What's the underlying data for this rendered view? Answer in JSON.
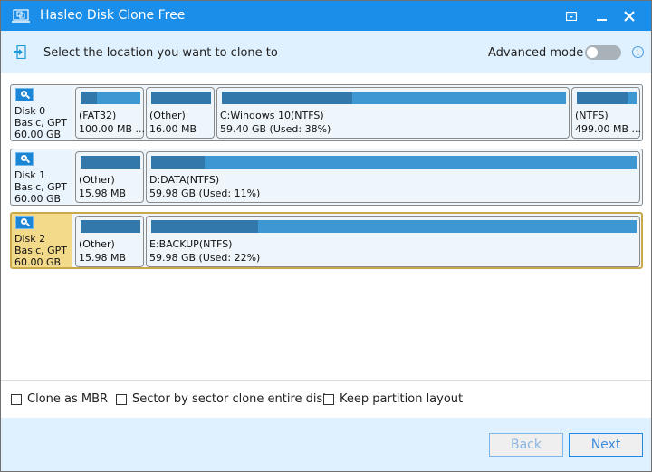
{
  "window": {
    "title": "Hasleo Disk Clone Free",
    "controls": [
      "menu",
      "minimize",
      "close"
    ]
  },
  "header": {
    "instruction": "Select the location you want to clone to",
    "advanced_mode_label": "Advanced mode",
    "advanced_mode_on": false
  },
  "disks": [
    {
      "name": "Disk 0",
      "type": "Basic, GPT",
      "size": "60.00 GB",
      "selected": false,
      "partitions": [
        {
          "name": "(FAT32)",
          "size": "100.00 MB ...",
          "used_fraction": 0.28
        },
        {
          "name": "(Other)",
          "size": "16.00 MB",
          "used_fraction": 1.0
        },
        {
          "name": "C:Windows 10(NTFS)",
          "size": "59.40 GB (Used: 38%)",
          "used_fraction": 0.38
        },
        {
          "name": "(NTFS)",
          "size": "499.00 MB ...",
          "used_fraction": 0.85
        }
      ]
    },
    {
      "name": "Disk 1",
      "type": "Basic, GPT",
      "size": "60.00 GB",
      "selected": false,
      "partitions": [
        {
          "name": "(Other)",
          "size": "15.98 MB",
          "used_fraction": 1.0
        },
        {
          "name": "D:DATA(NTFS)",
          "size": "59.98 GB (Used: 11%)",
          "used_fraction": 0.11
        }
      ]
    },
    {
      "name": "Disk 2",
      "type": "Basic, GPT",
      "size": "60.00 GB",
      "selected": true,
      "partitions": [
        {
          "name": "(Other)",
          "size": "15.98 MB",
          "used_fraction": 1.0
        },
        {
          "name": "E:BACKUP(NTFS)",
          "size": "59.98 GB (Used: 22%)",
          "used_fraction": 0.22
        }
      ]
    }
  ],
  "options": [
    {
      "label": "Clone as MBR",
      "checked": false
    },
    {
      "label": "Sector by sector clone entire disk",
      "checked": false
    },
    {
      "label": "Keep partition layout",
      "checked": false
    }
  ],
  "footer": {
    "back_label": "Back",
    "back_enabled": false,
    "next_label": "Next"
  },
  "colors": {
    "titlebar": "#1a8ee8",
    "header_bg": "#dff0fe",
    "bar_free": "#3d97d3",
    "bar_used": "#3378aa",
    "selected_disk": "#f3d98a"
  }
}
